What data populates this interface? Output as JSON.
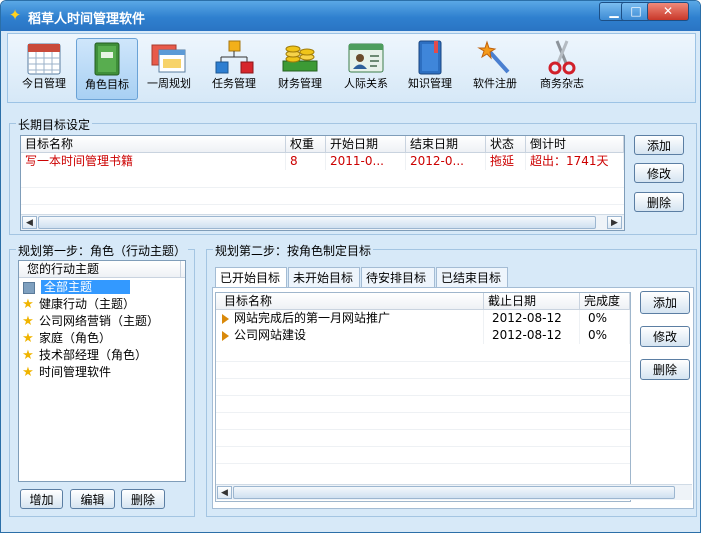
{
  "window": {
    "title": "稻草人时间管理软件",
    "minimize": "▁",
    "maximize": "□",
    "close": "✕"
  },
  "toolbar": [
    {
      "label": "今日管理",
      "icon": "calendar-icon"
    },
    {
      "label": "角色目标",
      "icon": "book-icon"
    },
    {
      "label": "一周规划",
      "icon": "windows-icon"
    },
    {
      "label": "任务管理",
      "icon": "hierarchy-icon"
    },
    {
      "label": "财务管理",
      "icon": "coins-icon"
    },
    {
      "label": "人际关系",
      "icon": "contact-card-icon"
    },
    {
      "label": "知识管理",
      "icon": "notebook-icon"
    },
    {
      "label": "软件注册",
      "icon": "magic-wand-icon"
    },
    {
      "label": "商务杂志",
      "icon": "scissors-icon"
    }
  ],
  "long_term": {
    "title": "长期目标设定",
    "columns": [
      "目标名称",
      "权重",
      "开始日期",
      "结束日期",
      "状态",
      "倒计时"
    ],
    "rows": [
      {
        "name": "写一本时间管理书籍",
        "weight": "8",
        "start": "2011-0...",
        "end": "2012-0...",
        "status": "拖延",
        "countdown": "超出：1741天"
      }
    ],
    "buttons": {
      "add": "添加",
      "edit": "修改",
      "delete": "删除"
    }
  },
  "step1": {
    "title": "规划第一步：角色（行动主题）",
    "header": "您的行动主题",
    "items": [
      {
        "label": "全部主题",
        "icon": "all-themes-icon",
        "selected": true
      },
      {
        "label": "健康行动（主题）",
        "icon": "star-icon"
      },
      {
        "label": "公司网络营销（主题）",
        "icon": "star-icon"
      },
      {
        "label": "家庭（角色）",
        "icon": "star-icon"
      },
      {
        "label": "技术部经理（角色）",
        "icon": "star-icon"
      },
      {
        "label": "时间管理软件",
        "icon": "star-icon"
      }
    ],
    "buttons": {
      "add": "增加",
      "edit": "编辑",
      "delete": "删除"
    }
  },
  "step2": {
    "title": "规划第二步：按角色制定目标",
    "tabs": [
      "已开始目标",
      "未开始目标",
      "待安排目标",
      "已结束目标"
    ],
    "columns": [
      "目标名称",
      "截止日期",
      "完成度"
    ],
    "rows": [
      {
        "name": "网站完成后的第一月网站推广",
        "deadline": "2012-08-12",
        "progress": "0%"
      },
      {
        "name": "公司网站建设",
        "deadline": "2012-08-12",
        "progress": "0%"
      }
    ],
    "buttons": {
      "add": "添加",
      "edit": "修改",
      "delete": "删除"
    }
  },
  "colors": {
    "accent": "#2f80cf",
    "overdue_text": "#cc0000",
    "selection": "#3399ff"
  }
}
